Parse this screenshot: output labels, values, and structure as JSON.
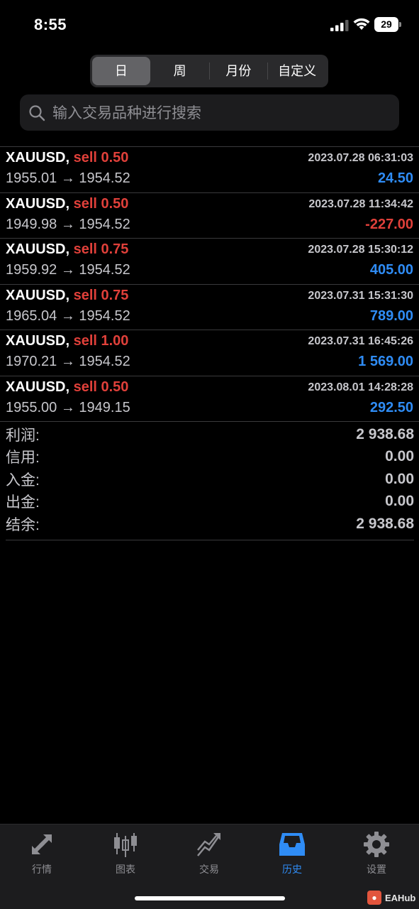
{
  "status_bar": {
    "time": "8:55",
    "battery": "29"
  },
  "period_tabs": [
    "日",
    "周",
    "月份",
    "自定义"
  ],
  "active_period": 0,
  "search": {
    "placeholder": "输入交易品种进行搜索"
  },
  "trades": [
    {
      "symbol": "XAUUSD,",
      "side": "sell",
      "volume": "0.50",
      "datetime": "2023.07.28 06:31:03",
      "prices": "1955.01 → 1954.52",
      "profit": "24.50",
      "profit_sign": "pos"
    },
    {
      "symbol": "XAUUSD,",
      "side": "sell",
      "volume": "0.50",
      "datetime": "2023.07.28 11:34:42",
      "prices": "1949.98 → 1954.52",
      "profit": "-227.00",
      "profit_sign": "neg"
    },
    {
      "symbol": "XAUUSD,",
      "side": "sell",
      "volume": "0.75",
      "datetime": "2023.07.28 15:30:12",
      "prices": "1959.92 → 1954.52",
      "profit": "405.00",
      "profit_sign": "pos"
    },
    {
      "symbol": "XAUUSD,",
      "side": "sell",
      "volume": "0.75",
      "datetime": "2023.07.31 15:31:30",
      "prices": "1965.04 → 1954.52",
      "profit": "789.00",
      "profit_sign": "pos"
    },
    {
      "symbol": "XAUUSD,",
      "side": "sell",
      "volume": "1.00",
      "datetime": "2023.07.31 16:45:26",
      "prices": "1970.21 → 1954.52",
      "profit": "1 569.00",
      "profit_sign": "pos"
    },
    {
      "symbol": "XAUUSD,",
      "side": "sell",
      "volume": "0.50",
      "datetime": "2023.08.01 14:28:28",
      "prices": "1955.00 → 1949.15",
      "profit": "292.50",
      "profit_sign": "pos"
    }
  ],
  "summary": [
    {
      "label": "利润:",
      "value": "2 938.68"
    },
    {
      "label": "信用:",
      "value": "0.00"
    },
    {
      "label": "入金:",
      "value": "0.00"
    },
    {
      "label": "出金:",
      "value": "0.00"
    },
    {
      "label": "结余:",
      "value": "2 938.68"
    }
  ],
  "tabbar": [
    {
      "label": "行情",
      "icon": "quotes-arrows-icon"
    },
    {
      "label": "图表",
      "icon": "candlestick-chart-icon"
    },
    {
      "label": "交易",
      "icon": "trade-chart-icon"
    },
    {
      "label": "历史",
      "icon": "history-inbox-icon"
    },
    {
      "label": "设置",
      "icon": "gear-icon"
    }
  ],
  "active_tab": 3,
  "colors": {
    "profit_positive": "#2f8cf5",
    "profit_negative": "#e0403a",
    "sell": "#e0403a",
    "active_tab": "#2f8cf5"
  },
  "watermark": "EAHub"
}
